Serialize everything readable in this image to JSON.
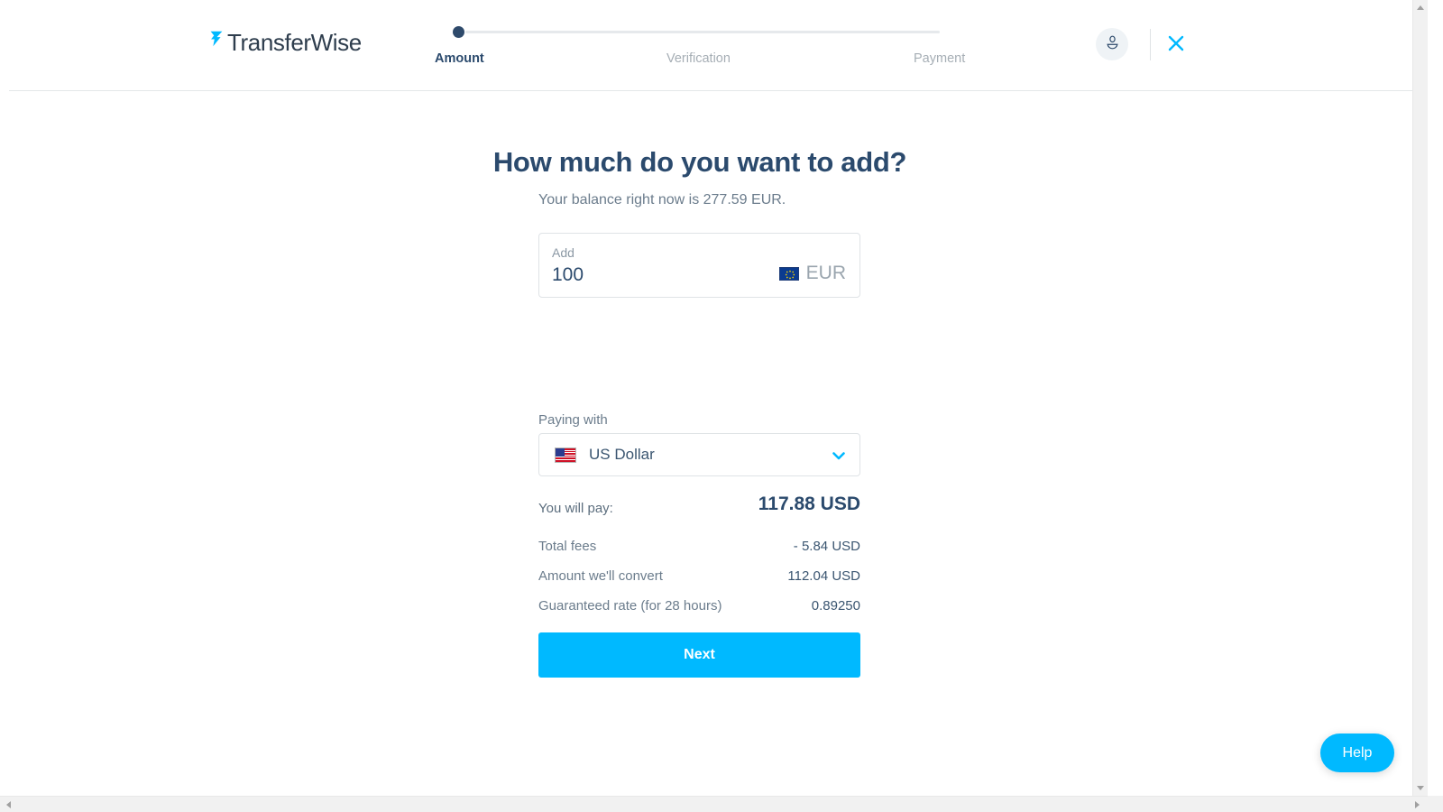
{
  "header": {
    "logo_text": "TransferWise",
    "logo_mark_icon": "transferwise-arrow-icon",
    "avatar_icon": "user-avatar-icon",
    "close_icon": "close-x-icon",
    "accent_color": "#00b9ff",
    "steps": [
      {
        "label": "Amount",
        "state": "active"
      },
      {
        "label": "Verification",
        "state": "upcoming"
      },
      {
        "label": "Payment",
        "state": "upcoming"
      }
    ]
  },
  "main": {
    "title": "How much do you want to add?",
    "balance_text": "Your balance right now is 277.59 EUR.",
    "amount": {
      "label": "Add",
      "value": "100",
      "placeholder": "0",
      "currency_code": "EUR",
      "currency_flag_icon": "flag-eu-icon"
    },
    "paying_with": {
      "label": "Paying with",
      "selected": "US Dollar",
      "flag_icon": "flag-us-icon",
      "chevron_icon": "chevron-down-icon"
    },
    "summary": [
      {
        "label": "You will pay:",
        "value": "117.88 USD",
        "emphasis": true
      },
      {
        "label": "Total fees",
        "value": "- 5.84 USD",
        "emphasis": false
      },
      {
        "label": "Amount we'll convert",
        "value": "112.04 USD",
        "emphasis": false
      },
      {
        "label": "Guaranteed rate (for 28 hours)",
        "value": "0.89250",
        "emphasis": false
      }
    ],
    "next_label": "Next"
  },
  "help": {
    "label": "Help"
  },
  "scrollbars": {
    "vertical_up_icon": "scroll-up-arrow-icon",
    "vertical_down_icon": "scroll-down-arrow-icon",
    "horizontal_left_icon": "scroll-left-arrow-icon",
    "horizontal_right_icon": "scroll-right-arrow-icon"
  }
}
